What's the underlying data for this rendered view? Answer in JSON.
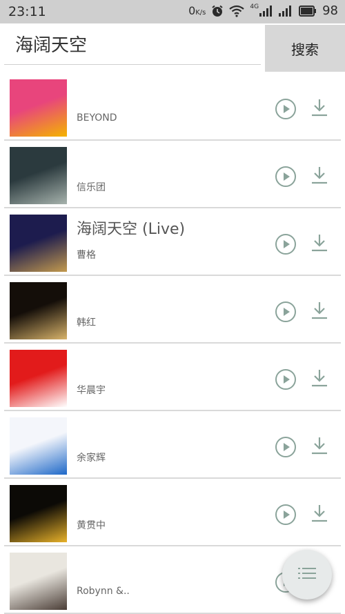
{
  "status_bar": {
    "time": "23:11",
    "net_speed": "0",
    "net_speed_unit": "K/s",
    "signal_type": "4G",
    "battery": "98"
  },
  "search": {
    "query": "海阔天空",
    "button_label": "搜索"
  },
  "songs": [
    {
      "title": "",
      "artist": "BEYOND",
      "cover_colors": [
        "#e8457c",
        "#f4b400"
      ]
    },
    {
      "title": "",
      "artist": "信乐团",
      "cover_colors": [
        "#2b3a3e",
        "#a7b3ad"
      ]
    },
    {
      "title": "海阔天空 (Live)",
      "artist": "曹格",
      "cover_colors": [
        "#1d1c4e",
        "#c39a4e"
      ]
    },
    {
      "title": "",
      "artist": "韩红",
      "cover_colors": [
        "#140e09",
        "#d8b36a"
      ]
    },
    {
      "title": "",
      "artist": "华晨宇",
      "cover_colors": [
        "#e21b1b",
        "#ffffff"
      ]
    },
    {
      "title": "",
      "artist": "余家辉",
      "cover_colors": [
        "#f4f6fb",
        "#1e68c8"
      ]
    },
    {
      "title": "",
      "artist": "黄贯中",
      "cover_colors": [
        "#0c0a06",
        "#e8b22a"
      ]
    },
    {
      "title": "",
      "artist": "Robynn &..",
      "cover_colors": [
        "#e9e6df",
        "#4a3d36"
      ]
    }
  ],
  "colors": {
    "accent": "#8aa39a",
    "status_bar": "#cfcfcf",
    "button_bg": "#d7d7d7"
  },
  "icons": {
    "play": "play-circle-icon",
    "download": "download-icon",
    "fab": "list-menu-icon"
  }
}
